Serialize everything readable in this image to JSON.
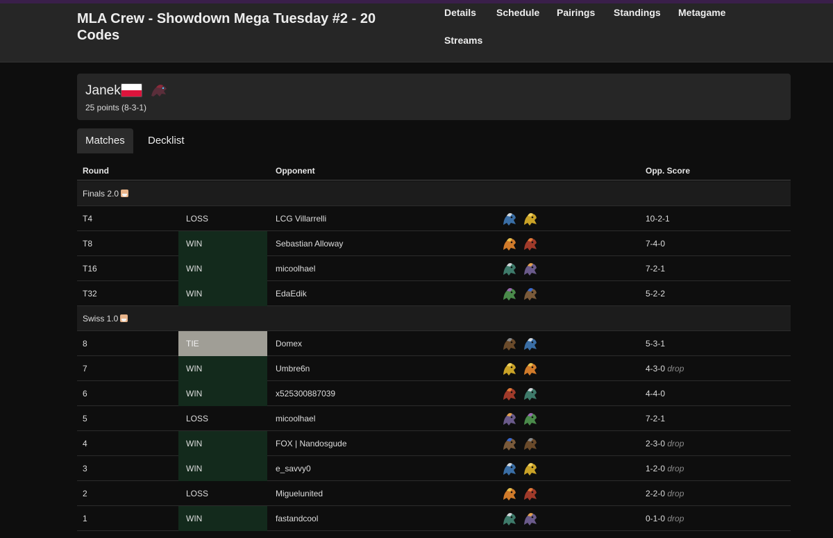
{
  "header": {
    "title": "MLA Crew - Showdown Mega Tuesday #2 - 20 Codes",
    "nav": [
      "Details",
      "Schedule",
      "Pairings",
      "Standings",
      "Metagame",
      "Streams"
    ]
  },
  "player": {
    "name": "Janek",
    "flag": "poland-flag",
    "points": "25 points (8-3-1)"
  },
  "tabs": [
    {
      "label": "Matches",
      "active": true
    },
    {
      "label": "Decklist",
      "active": false
    }
  ],
  "table": {
    "headers": {
      "round": "Round",
      "opponent": "Opponent",
      "score": "Opp. Score"
    },
    "sections": [
      {
        "label": "Finals 2.0",
        "icon": "santa-icon"
      },
      {
        "label": "Swiss 1.0",
        "icon": "santa-icon"
      }
    ],
    "rows": [
      {
        "round": "T4",
        "result": "LOSS",
        "opponent": "LCG Villarrelli",
        "score": "10-2-1",
        "drop": ""
      },
      {
        "round": "T8",
        "result": "WIN",
        "opponent": "Sebastian Alloway",
        "score": "7-4-0",
        "drop": ""
      },
      {
        "round": "T16",
        "result": "WIN",
        "opponent": "micoolhael",
        "score": "7-2-1",
        "drop": ""
      },
      {
        "round": "T32",
        "result": "WIN",
        "opponent": "EdaEdik",
        "score": "5-2-2",
        "drop": ""
      },
      {
        "round": "8",
        "result": "TIE",
        "opponent": "Domex",
        "score": "5-3-1",
        "drop": ""
      },
      {
        "round": "7",
        "result": "WIN",
        "opponent": "Umbre6n",
        "score": "4-3-0",
        "drop": "drop"
      },
      {
        "round": "6",
        "result": "WIN",
        "opponent": "x525300887039",
        "score": "4-4-0",
        "drop": ""
      },
      {
        "round": "5",
        "result": "LOSS",
        "opponent": "micoolhael",
        "score": "7-2-1",
        "drop": ""
      },
      {
        "round": "4",
        "result": "WIN",
        "opponent": "FOX | Nandosgude",
        "score": "2-3-0",
        "drop": "drop"
      },
      {
        "round": "3",
        "result": "WIN",
        "opponent": "e_savvy0",
        "score": "1-2-0",
        "drop": "drop"
      },
      {
        "round": "2",
        "result": "LOSS",
        "opponent": "Miguelunited",
        "score": "2-2-0",
        "drop": "drop"
      },
      {
        "round": "1",
        "result": "WIN",
        "opponent": "fastandcool",
        "score": "0-1-0",
        "drop": "drop"
      }
    ]
  },
  "colors": {
    "win_bg": "#132a1c",
    "tie_bg": "#a09e96",
    "header_bg": "#262626",
    "page_bg": "#0e0e0e"
  }
}
